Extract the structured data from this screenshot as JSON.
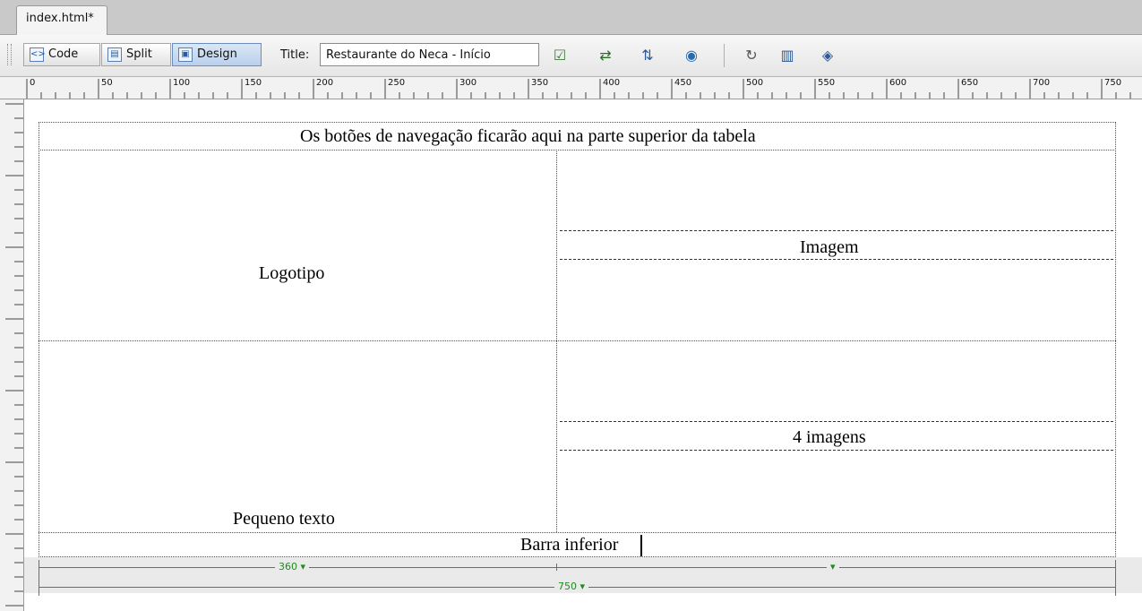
{
  "document": {
    "tab_label": "index.html*"
  },
  "toolbar": {
    "code_label": "Code",
    "split_label": "Split",
    "design_label": "Design",
    "title_label": "Title:",
    "title_value": "Restaurante do Neca - Início",
    "tools": [
      "validate-markup-icon",
      "file-management-icon",
      "preview-icon",
      "browser-check-icon",
      "refresh-icon",
      "view-options-icon",
      "visual-aids-icon"
    ]
  },
  "ruler": {
    "marks": [
      "0",
      "50",
      "100",
      "150",
      "200",
      "250",
      "300",
      "350",
      "400",
      "450",
      "500",
      "550",
      "600",
      "650",
      "700",
      "750"
    ]
  },
  "table": {
    "header_text": "Os botões de navegação ficarão aqui na parte superior da tabela",
    "logo_text": "Logotipo",
    "image_text": "Imagem",
    "four_images_text": "4 imagens",
    "small_text": "Pequeno texto",
    "footer_text": "Barra inferior",
    "column_width_label": "360",
    "table_width_label": "750"
  },
  "colors": {
    "width_guide": "#2a9a2a",
    "tab_bar": "#c9c9c9",
    "active_view": "#b9d0ec"
  }
}
